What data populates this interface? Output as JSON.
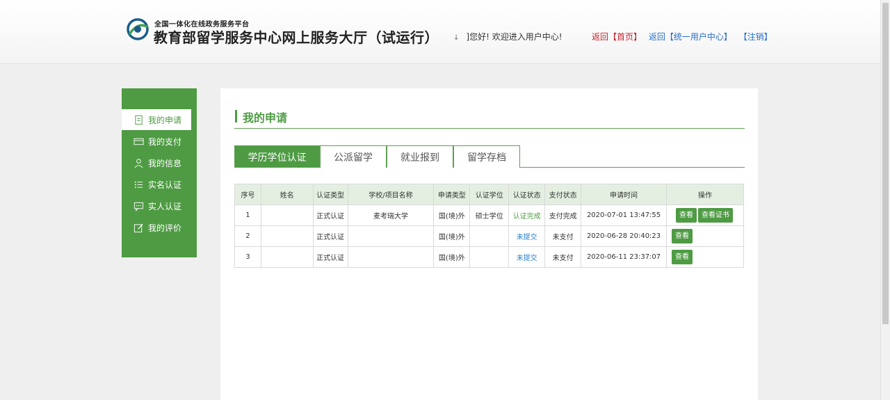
{
  "header": {
    "small_title": "全国一体化在线政务服务平台",
    "title": "教育部留学服务中心网上服务大厅（试运行）",
    "caret": "↓",
    "greeting": "]您好!  欢迎进入用户中心!",
    "link_home": "返回【首页】",
    "link_unified": "返回【统一用户中心】",
    "link_logout": "【注销】"
  },
  "sidebar": {
    "items": [
      {
        "label": "我的申请",
        "icon": "doc-icon"
      },
      {
        "label": "我的支付",
        "icon": "card-icon"
      },
      {
        "label": "我的信息",
        "icon": "user-icon"
      },
      {
        "label": "实名认证",
        "icon": "list-icon"
      },
      {
        "label": "实人认证",
        "icon": "chat-icon"
      },
      {
        "label": "我的评价",
        "icon": "edit-icon"
      }
    ]
  },
  "main": {
    "title": "我的申请",
    "tabs": [
      {
        "label": "学历学位认证",
        "active": true
      },
      {
        "label": "公派留学"
      },
      {
        "label": "就业报到"
      },
      {
        "label": "留学存档"
      }
    ],
    "table": {
      "headers": [
        "序号",
        "姓名",
        "认证类型",
        "学校/项目名称",
        "申请类型",
        "认证学位",
        "认证状态",
        "支付状态",
        "申请时间",
        "操作"
      ],
      "rows": [
        {
          "no": "1",
          "name": "",
          "type": "正式认证",
          "school": "麦考瑞大学",
          "apply_type": "国(境)外",
          "degree": "硕士学位",
          "status": "认证完成",
          "pay": "支付完成",
          "time": "2020-07-01 13:47:55",
          "btn_view": "查看",
          "btn_cert": "查看证书"
        },
        {
          "no": "2",
          "name": "",
          "type": "正式认证",
          "school": "",
          "apply_type": "国(境)外",
          "degree": "",
          "status": "未提交",
          "pay": "未支付",
          "time": "2020-06-28 20:40:23",
          "btn_view": "查看"
        },
        {
          "no": "3",
          "name": "",
          "type": "正式认证",
          "school": "",
          "apply_type": "国(境)外",
          "degree": "",
          "status": "未提交",
          "pay": "未支付",
          "time": "2020-06-11 23:37:07",
          "btn_view": "查看"
        }
      ]
    }
  },
  "colors": {
    "brand_green": "#4e9b43",
    "link_red": "#c6202b",
    "link_blue": "#2a6fc9"
  }
}
